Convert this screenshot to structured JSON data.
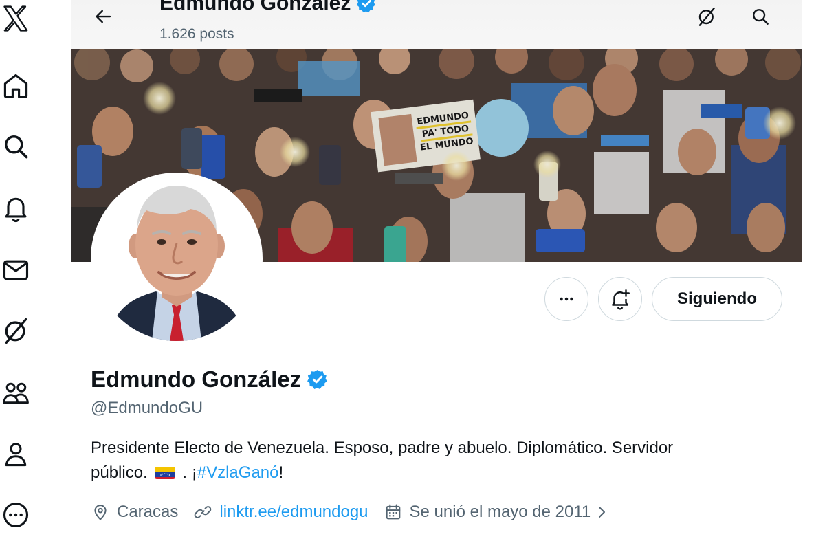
{
  "header": {
    "name": "Edmundo González",
    "posts": "1.626 posts"
  },
  "nav": {
    "items": [
      "x-logo",
      "home",
      "explore",
      "notifications",
      "messages",
      "grok",
      "communities",
      "profile",
      "more"
    ]
  },
  "banner": {
    "sign_text": [
      "EDMUNDO",
      "PA' TODO",
      "EL MUNDO"
    ]
  },
  "actions": {
    "follow_label": "Siguiendo"
  },
  "profile": {
    "name": "Edmundo González",
    "handle": "@EdmundoGU",
    "bio_line1": "Presidente Electo de Venezuela. Esposo, padre y abuelo. Diplomático. Servidor",
    "bio_line2_start": "público.",
    "bio_line2_mid": ". ¡",
    "hashtag": "#VzlaGanó",
    "bio_line2_end": "!",
    "location": "Caracas",
    "link": "linktr.ee/edmundogu",
    "joined": "Se unió el mayo de 2011"
  },
  "colors": {
    "accent": "#1d9bf0",
    "text": "#0f1419",
    "secondary": "#536471"
  }
}
